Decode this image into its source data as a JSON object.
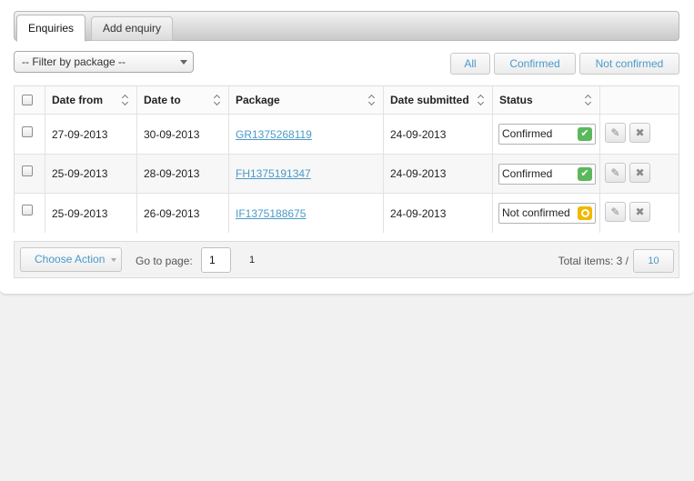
{
  "tabs": [
    {
      "label": "Enquiries",
      "active": true
    },
    {
      "label": "Add enquiry",
      "active": false
    }
  ],
  "filter": {
    "selected": "-- Filter by package --"
  },
  "status_filters": [
    "All",
    "Confirmed",
    "Not confirmed"
  ],
  "table": {
    "headers": [
      "Date from",
      "Date to",
      "Package",
      "Date submitted",
      "Status"
    ],
    "rows": [
      {
        "date_from": "27-09-2013",
        "date_to": "30-09-2013",
        "package": "GR1375268119",
        "date_submitted": "24-09-2013",
        "status": "Confirmed",
        "status_icon": "check-icon"
      },
      {
        "date_from": "25-09-2013",
        "date_to": "28-09-2013",
        "package": "FH1375191347",
        "date_submitted": "24-09-2013",
        "status": "Confirmed",
        "status_icon": "check-icon"
      },
      {
        "date_from": "25-09-2013",
        "date_to": "26-09-2013",
        "package": "IF1375188675",
        "date_submitted": "24-09-2013",
        "status": "Not confirmed",
        "status_icon": "circle-icon"
      }
    ]
  },
  "colors": {
    "confirmed": "#5cb85c",
    "not_confirmed": "#f0b800",
    "link": "#4a9ac8"
  },
  "footer": {
    "choose_action": "Choose Action",
    "goto_label": "Go to page:",
    "page_value": "1",
    "page_count": "1",
    "total_label": "Total items: 3 /",
    "per_page": "10"
  }
}
